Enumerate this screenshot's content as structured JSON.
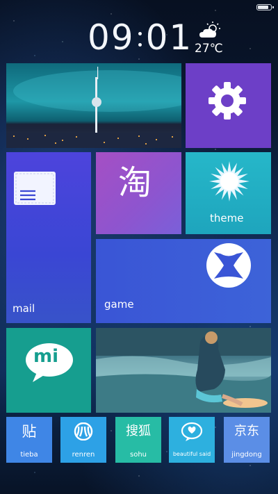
{
  "status_bar": {
    "battery_level": 0.85
  },
  "clock": {
    "hours": "09",
    "minutes": "01"
  },
  "weather": {
    "temperature": "27℃",
    "icon": "partly-cloudy-icon"
  },
  "tiles": {
    "settings": {
      "icon": "gear-icon"
    },
    "mail": {
      "label": "mail",
      "icon": "envelope-icon"
    },
    "taobao": {
      "label": "淘"
    },
    "theme": {
      "label": "theme",
      "icon": "sun-burst-icon"
    },
    "game": {
      "label": "game",
      "icon": "xbox-icon"
    },
    "mi": {
      "label": "mi"
    }
  },
  "dock": [
    {
      "glyph": "贴",
      "name": "tieba",
      "color": "#3f86e6"
    },
    {
      "glyph": "",
      "name": "renren",
      "icon": "renren-icon",
      "color": "#2da1e6"
    },
    {
      "glyph": "搜狐",
      "name": "sohu",
      "color": "#27bca5"
    },
    {
      "glyph": "",
      "name": "beautiful said",
      "icon": "heart-bubble-icon",
      "color": "#2db0df"
    },
    {
      "glyph": "京东",
      "name": "jingdong",
      "color": "#5b8ee6"
    }
  ]
}
